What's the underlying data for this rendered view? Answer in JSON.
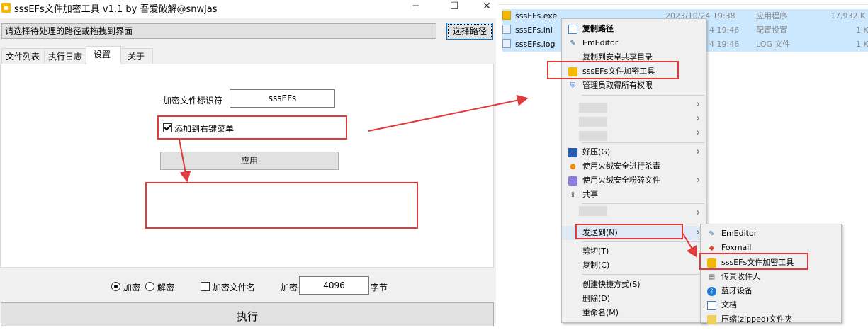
{
  "window": {
    "title": "sssEFs文件加密工具 v1.1 by 吾爱破解@snwjas",
    "minimize": "─",
    "maximize": "☐",
    "close": "✕"
  },
  "toolbar": {
    "path_placeholder": "请选择待处理的路径或拖拽到界面",
    "choose_path_label": "选择路径"
  },
  "tabs": [
    {
      "label": "文件列表"
    },
    {
      "label": "执行日志"
    },
    {
      "label": "设置"
    },
    {
      "label": "关于"
    }
  ],
  "settings": {
    "marker_label": "加密文件标识符",
    "marker_value": "sssEFs",
    "context_menu_label": "添加到右键菜单",
    "context_menu_checked": true,
    "apply_label": "应用"
  },
  "options": {
    "encrypt_label": "加密",
    "decrypt_label": "解密",
    "encrypt_name_label": "加密文件名",
    "size_label": "加密",
    "size_value": "4096",
    "size_unit": "字节",
    "execute_label": "执行"
  },
  "explorer": {
    "files": [
      {
        "name": "sssEFs.exe",
        "date": "2023/10/24 19:38",
        "type": "应用程序",
        "size": "17,932 K"
      },
      {
        "name": "sssEFs.ini",
        "date": "4 19:46",
        "type": "配置设置",
        "size": "1 K"
      },
      {
        "name": "sssEFs.log",
        "date": "4 19:46",
        "type": "LOG 文件",
        "size": "1 K"
      }
    ]
  },
  "context_menu": {
    "items": [
      {
        "label": "复制路径"
      },
      {
        "label": "EmEditor"
      },
      {
        "label": "复制到安卓共享目录"
      },
      {
        "label": "sssEFs文件加密工具"
      },
      {
        "label": "管理员取得所有权限"
      },
      {
        "label": "好压(G)"
      },
      {
        "label": "使用火绒安全进行杀毒"
      },
      {
        "label": "使用火绒安全粉碎文件"
      },
      {
        "label": "共享"
      },
      {
        "label": "发送到(N)"
      },
      {
        "label": "剪切(T)"
      },
      {
        "label": "复制(C)"
      },
      {
        "label": "创建快捷方式(S)"
      },
      {
        "label": "删除(D)"
      },
      {
        "label": "重命名(M)"
      }
    ]
  },
  "sendto_menu": {
    "items": [
      {
        "label": "EmEditor"
      },
      {
        "label": "Foxmail"
      },
      {
        "label": "sssEFs文件加密工具"
      },
      {
        "label": "传真收件人"
      },
      {
        "label": "蓝牙设备"
      },
      {
        "label": "文档"
      },
      {
        "label": "压缩(zipped)文件夹"
      }
    ]
  },
  "colors": {
    "highlight_red": "#e03a3a",
    "selection_blue": "#cce8ff",
    "window_bg": "#f0f0f0"
  }
}
